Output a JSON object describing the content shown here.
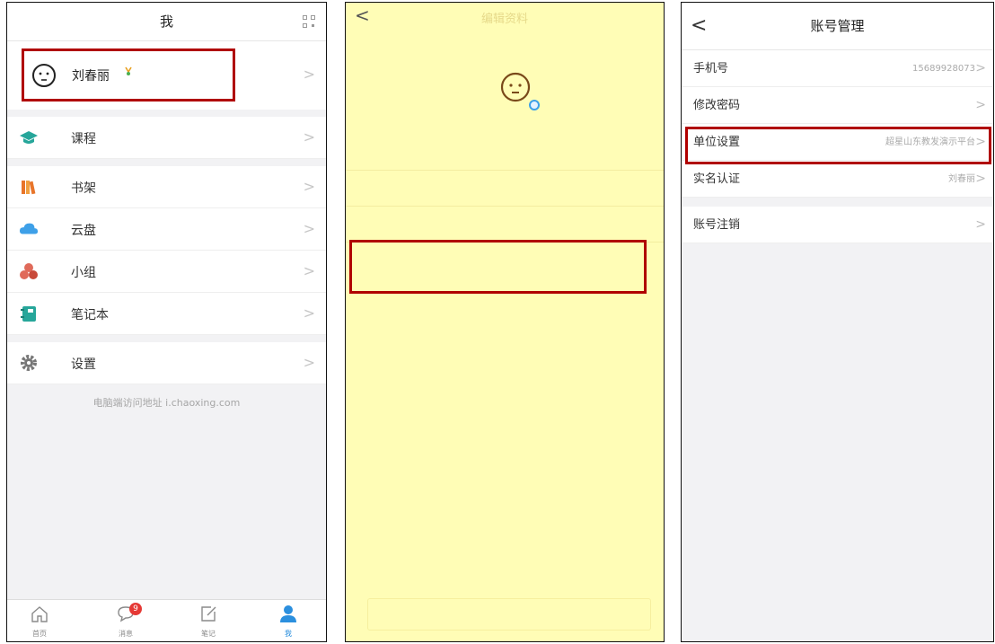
{
  "panel_me": {
    "title": "我",
    "user_name": "刘春丽",
    "menu": [
      {
        "label": "课程",
        "icon": "graduation-cap-icon"
      },
      {
        "label": "书架",
        "icon": "bookshelf-icon"
      },
      {
        "label": "云盘",
        "icon": "cloud-icon"
      },
      {
        "label": "小组",
        "icon": "group-icon"
      },
      {
        "label": "笔记本",
        "icon": "notebook-icon"
      },
      {
        "label": "设置",
        "icon": "gear-icon"
      }
    ],
    "footer_text": "电脑端访问地址 i.chaoxing.com",
    "tabs": [
      {
        "label": "首页",
        "icon": "home-icon"
      },
      {
        "label": "消息",
        "icon": "message-icon",
        "badge": "9"
      },
      {
        "label": "笔记",
        "icon": "note-edit-icon"
      },
      {
        "label": "我",
        "icon": "person-icon"
      }
    ]
  },
  "panel_profile": {
    "title": "编辑资料"
  },
  "panel_account": {
    "title": "账号管理",
    "rows": [
      {
        "label": "手机号",
        "value": "15689928073"
      },
      {
        "label": "修改密码",
        "value": ""
      },
      {
        "label": "单位设置",
        "value": "超星山东教发演示平台"
      },
      {
        "label": "实名认证",
        "value": "刘春丽"
      },
      {
        "label": "账号注销",
        "value": ""
      }
    ]
  },
  "colors": {
    "highlight": "#b00000",
    "accent_blue": "#2b8fde",
    "badge_red": "#e53935",
    "profile_bg": "#fffdb6"
  }
}
